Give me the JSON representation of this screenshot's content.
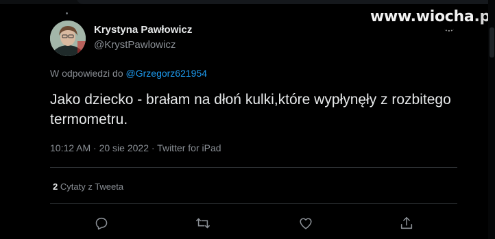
{
  "watermark": {
    "site": "www.wiocha",
    "tld": ".pl"
  },
  "tweet": {
    "author_name": "Krystyna Pawłowicz",
    "author_handle": "@KrystPawlowicz",
    "reply_prefix": "W odpowiedzi do ",
    "reply_mention": "@Grzegorz621954",
    "text": "Jako dziecko - brałam na dłoń kulki,które wypłynęły z rozbitego termometru.",
    "meta": "10:12 AM · 20 sie 2022 · Twitter for iPad",
    "quote_count": "2",
    "quote_label": "Cytaty z Tweeta"
  },
  "actions": [
    {
      "icon": "reply-icon"
    },
    {
      "icon": "retweet-icon"
    },
    {
      "icon": "like-icon"
    },
    {
      "icon": "share-icon"
    }
  ],
  "colors": {
    "background": "#000000",
    "text": "#e7e9ea",
    "muted": "#8b9096",
    "link": "#1d9bf0",
    "divider": "#2f3336"
  }
}
